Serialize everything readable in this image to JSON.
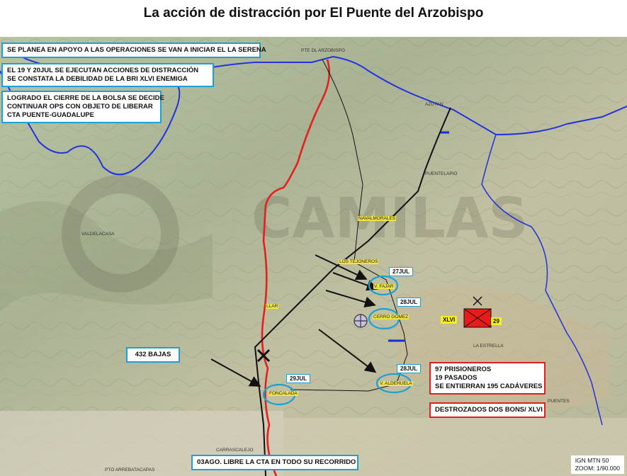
{
  "title": "La acción de distracción por El Puente del Arzobispo",
  "info_boxes": [
    {
      "lines": [
        "SE PLANEA EN APOYO A LAS OPERACIONES SE VAN A INICIAR EL LA SERENA"
      ]
    },
    {
      "lines": [
        "EL 19 Y 20JUL SE EJECUTAN ACCIONES DE DISTRACCIÓN",
        "SE CONSTATA LA DEBILIDAD DE  LA BRI XLVI ENEMIGA"
      ]
    },
    {
      "lines": [
        "LOGRADO EL CIERRE DE LA BOLSA SE DECIDE",
        "CONTINUAR OPS CON OBJETO DE LIBERAR",
        " CTA PUENTE-GUADALUPE"
      ]
    },
    {
      "lines": [
        "432 BAJAS"
      ]
    },
    {
      "lines": [
        "97 PRISIONEROS",
        "19 PASADOS",
        "SE ENTIERRAN 195 CADÁVERES"
      ]
    },
    {
      "lines": [
        "DESTROZADOS DOS BONS/ XLVI"
      ]
    },
    {
      "lines": [
        "03AGO. LIBRE LA CTA EN TODO SU RECORRIDO"
      ]
    }
  ],
  "places": {
    "pte_arzobispo": "PTE DL ARZOBISPO",
    "azutan": "AZUTAN",
    "puentelapio": "PUENTELAPIO",
    "navalmorales": "NAVALMORALES",
    "valdelacasa": "VALDELACASA",
    "tejoneras": "LOS TEJONEROS",
    "fajar": "V. FAJAR",
    "cerro_gomez": "CERRO GOMEZ",
    "villar": "LLAR",
    "la_estrella": "LA ESTRELLA",
    "aldehuela": "V. ALDEHUELA",
    "fontanarejo": "FONCALADA",
    "puentes": "PUENTES",
    "carrascalejo": "CARRASCALEJO",
    "pto_arrebatacapas": "PTO ARREBATACAPAS"
  },
  "dates": {
    "d1": "27JUL",
    "d2": "28JUL",
    "d3": "28JUL",
    "d4": "29JUL"
  },
  "enemy_unit": {
    "name": "XLVI",
    "number": "29"
  },
  "scale": {
    "line1": "IGN MTN 50",
    "line2": "ZOOM: 1/90.000"
  },
  "watermark": "CAMILAS",
  "colors": {
    "front_red": "#e62020",
    "river_blue": "#2233dd",
    "road": "#111111",
    "box_blue": "#1ba1d6",
    "box_red": "#e02020"
  }
}
